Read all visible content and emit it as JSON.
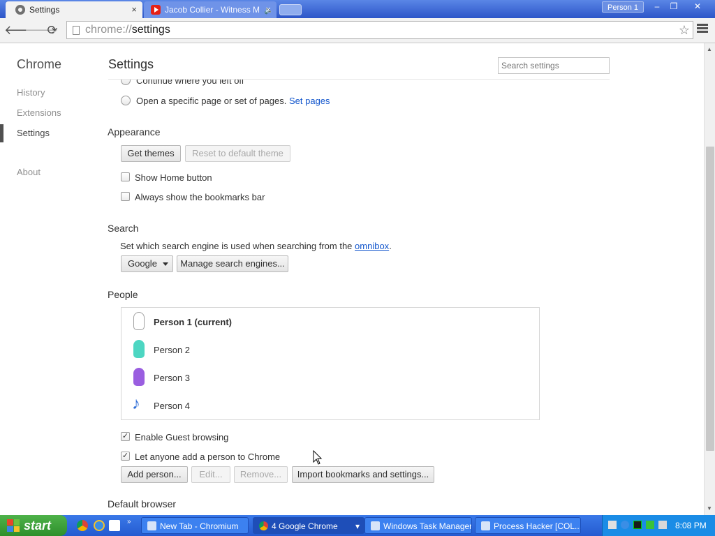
{
  "titlebar": {
    "tabs": [
      {
        "title": "Settings",
        "close": "×"
      },
      {
        "title": "Jacob Collier - Witness M",
        "close": "×"
      }
    ],
    "profile_badge": "Person 1",
    "window_buttons": {
      "minimize": "–",
      "restore": "❐",
      "close": "✕"
    }
  },
  "toolbar": {
    "back": "🡐",
    "forward": "🡒",
    "reload": "⟳",
    "url_scheme": "chrome://",
    "url_path": "settings",
    "star": "☆"
  },
  "sidebar": {
    "title": "Chrome",
    "items": [
      {
        "label": "History",
        "active": false
      },
      {
        "label": "Extensions",
        "active": false
      },
      {
        "label": "Settings",
        "active": true
      },
      {
        "label": "About",
        "active": false
      }
    ]
  },
  "page": {
    "title": "Settings",
    "search_placeholder": "Search settings"
  },
  "startup": {
    "continue_label": "Continue where you left off",
    "open_pages_label": "Open a specific page or set of pages.",
    "set_pages_link": "Set pages"
  },
  "appearance": {
    "heading": "Appearance",
    "get_themes": "Get themes",
    "reset_theme": "Reset to default theme",
    "show_home": "Show Home button",
    "show_home_checked": false,
    "bookmarks_bar": "Always show the bookmarks bar",
    "bookmarks_bar_checked": false
  },
  "search": {
    "heading": "Search",
    "description": "Set which search engine is used when searching from the",
    "omnibox_link": "omnibox",
    "period": ".",
    "engine": "Google",
    "manage": "Manage search engines..."
  },
  "people": {
    "heading": "People",
    "list": [
      {
        "name": "Person 1 (current)",
        "color": "#ffffff",
        "current": true
      },
      {
        "name": "Person 2",
        "color": "#4dd6c2",
        "current": false
      },
      {
        "name": "Person 3",
        "color": "#9a5ee0",
        "current": false
      },
      {
        "name": "Person 4",
        "color": "#2f6ed6",
        "current": false
      }
    ],
    "guest": "Enable Guest browsing",
    "guest_checked": true,
    "anyone_add": "Let anyone add a person to Chrome",
    "anyone_add_checked": true,
    "add_person": "Add person...",
    "edit": "Edit...",
    "remove": "Remove...",
    "import": "Import bookmarks and settings..."
  },
  "default_browser": {
    "heading": "Default browser"
  },
  "taskbar": {
    "start": "start",
    "tasks": [
      {
        "label": "New Tab - Chromium"
      },
      {
        "label": "4 Google Chrome"
      },
      {
        "label": "Windows Task Manager"
      },
      {
        "label": "Process Hacker [COL..."
      }
    ],
    "clock": "8:08 PM"
  },
  "colors": {
    "titlebar": "#2c55c8",
    "link": "#1155cc",
    "taskbar": "#245ad0",
    "start_green": "#2e8f2b"
  }
}
